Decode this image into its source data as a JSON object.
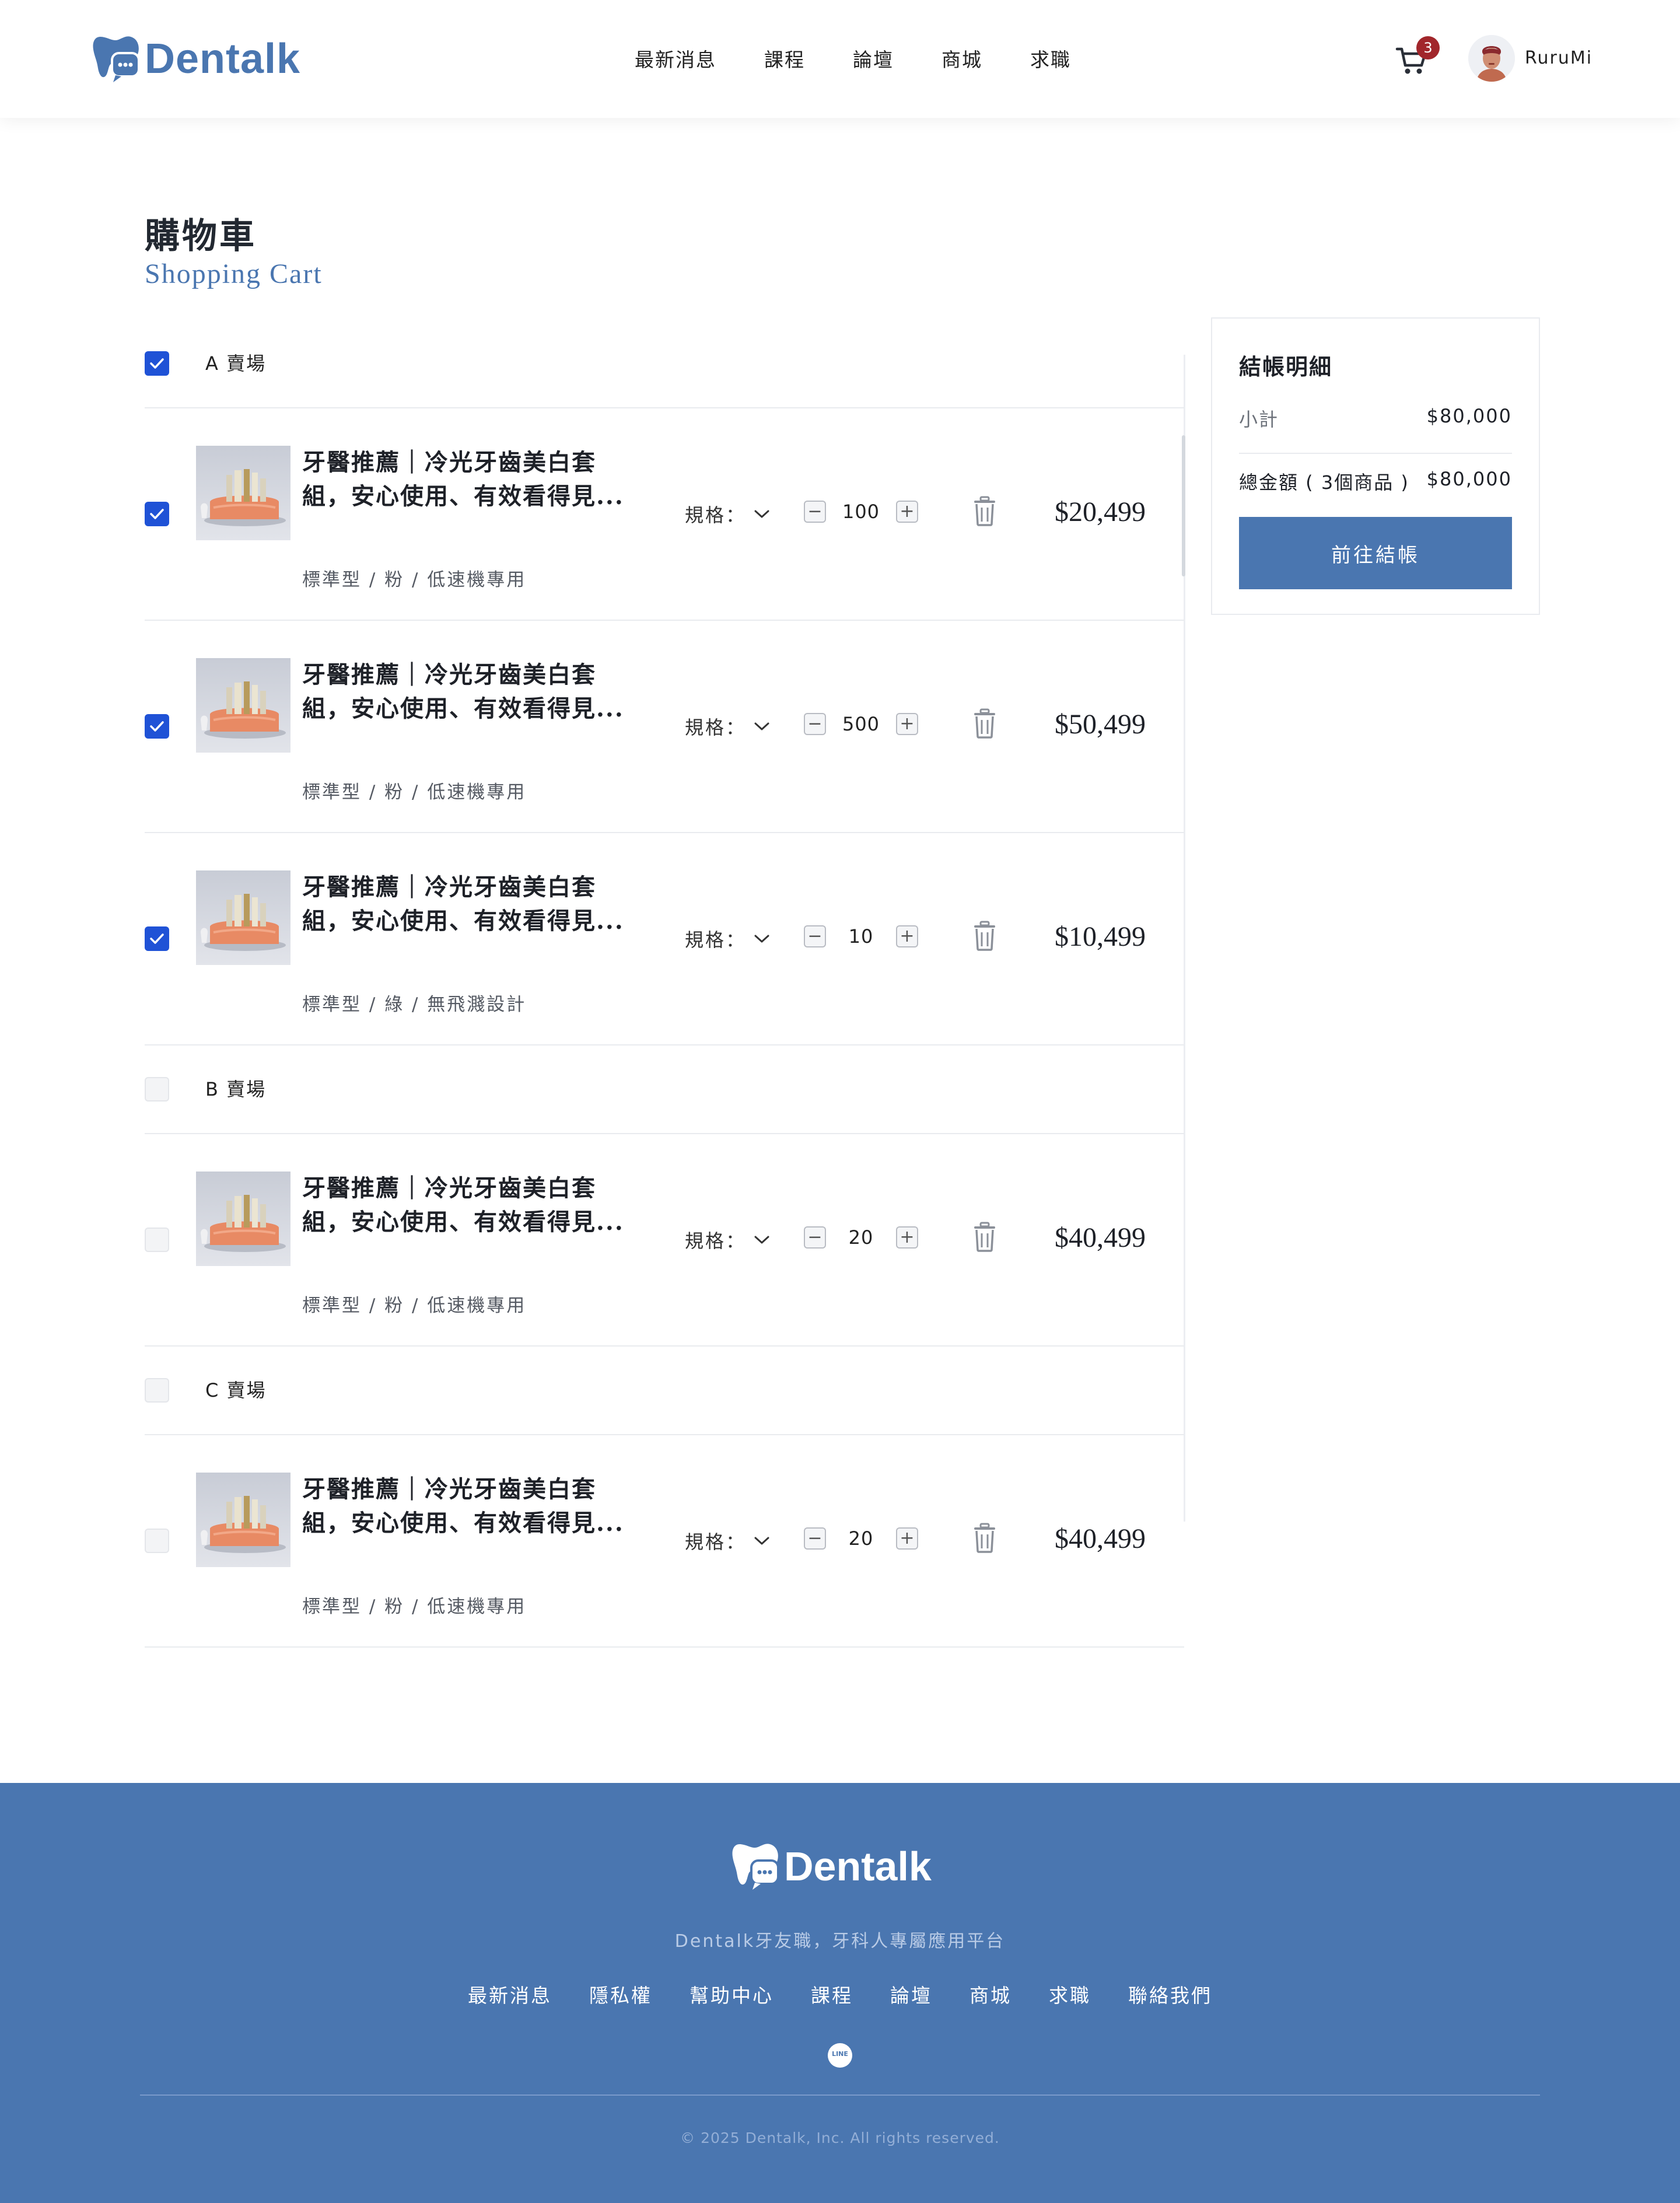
{
  "header": {
    "logo_text": "Dentalk",
    "nav": [
      "最新消息",
      "課程",
      "論壇",
      "商城",
      "求職"
    ],
    "cart_count": "3",
    "username": "RuruMi"
  },
  "page": {
    "title": "購物車",
    "subtitle": "Shopping Cart"
  },
  "cart": {
    "spec_label": "規格：",
    "stores": [
      {
        "label": "A 賣場",
        "checked": true
      },
      {
        "label": "B 賣場",
        "checked": false
      },
      {
        "label": "C 賣場",
        "checked": false
      }
    ],
    "items": [
      {
        "name": "牙醫推薦｜冷光牙齒美白套組，安心使用、有效看得見...",
        "variant": "標準型 / 粉 / 低速機專用",
        "qty": "100",
        "price": "$20,499",
        "checked": true
      },
      {
        "name": "牙醫推薦｜冷光牙齒美白套組，安心使用、有效看得見...",
        "variant": "標準型 / 粉 / 低速機專用",
        "qty": "500",
        "price": "$50,499",
        "checked": true
      },
      {
        "name": "牙醫推薦｜冷光牙齒美白套組，安心使用、有效看得見...",
        "variant": "標準型 / 綠 / 無飛濺設計",
        "qty": "10",
        "price": "$10,499",
        "checked": true
      },
      {
        "name": "牙醫推薦｜冷光牙齒美白套組，安心使用、有效看得見...",
        "variant": "標準型 / 粉 / 低速機專用",
        "qty": "20",
        "price": "$40,499",
        "checked": false
      },
      {
        "name": "牙醫推薦｜冷光牙齒美白套組，安心使用、有效看得見...",
        "variant": "標準型 / 粉 / 低速機專用",
        "qty": "20",
        "price": "$40,499",
        "checked": false
      }
    ]
  },
  "summary": {
    "title": "結帳明細",
    "subtotal_label": "小計",
    "subtotal_value": "$80,000",
    "total_label": "總金額 ( 3個商品 )",
    "total_value": "$80,000",
    "checkout_label": "前往結帳"
  },
  "footer": {
    "logo_text": "Dentalk",
    "tagline": "Dentalk牙友職，牙科人專屬應用平台",
    "nav": [
      "最新消息",
      "隱私權",
      "幫助中心",
      "課程",
      "論壇",
      "商城",
      "求職",
      "聯絡我們"
    ],
    "line_label": "LINE",
    "copyright": "© 2025 Dentalk, Inc. All rights reserved."
  },
  "colors": {
    "brand": "#4a76b0",
    "checkbox_on": "#1f52d6",
    "badge": "#a1262b"
  },
  "icons": {
    "cart": "shopping-cart-icon",
    "trash": "trash-icon",
    "chevron": "chevron-down-icon",
    "check": "check-icon",
    "line": "line-app-icon"
  }
}
